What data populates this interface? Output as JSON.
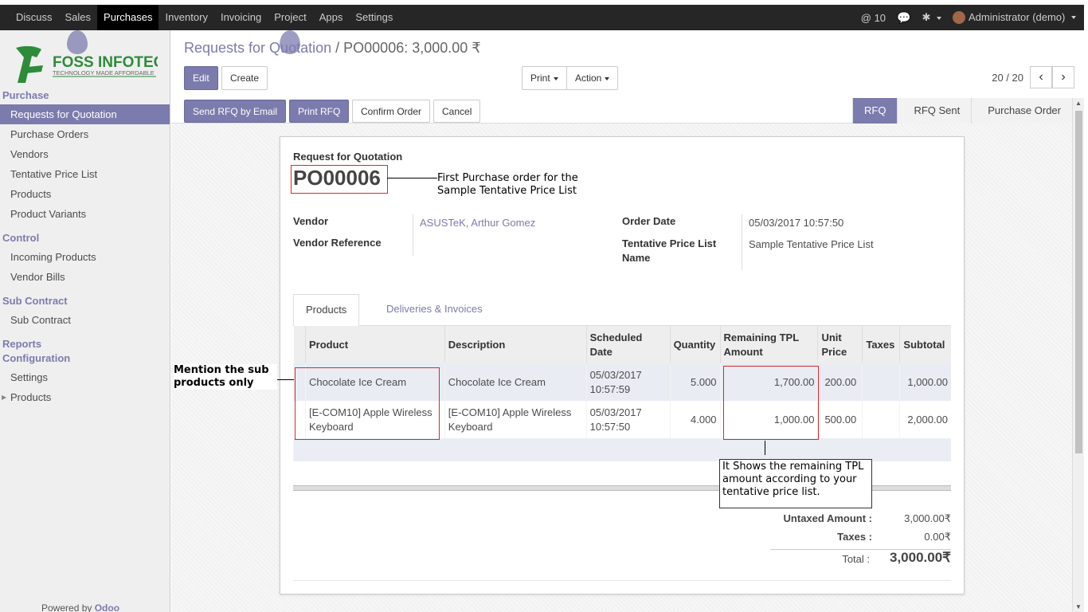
{
  "topbar": {
    "menus": [
      "Discuss",
      "Sales",
      "Purchases",
      "Inventory",
      "Invoicing",
      "Project",
      "Apps",
      "Settings"
    ],
    "active_menu": "Purchases",
    "notifications": "10",
    "user": "Administrator (demo)"
  },
  "sidebar": {
    "logo_text": "FOSS INFOTECH",
    "logo_tagline": "TECHNOLOGY MADE AFFORDABLE",
    "sections": {
      "purchase": "Purchase",
      "control": "Control",
      "sub_contract": "Sub Contract",
      "reports": "Reports",
      "configuration": "Configuration"
    },
    "items": {
      "rfq": "Requests for Quotation",
      "purchase_orders": "Purchase Orders",
      "vendors": "Vendors",
      "tentative_price_list": "Tentative Price List",
      "products": "Products",
      "product_variants": "Product Variants",
      "incoming_products": "Incoming Products",
      "vendor_bills": "Vendor Bills",
      "sub_contract": "Sub Contract",
      "settings": "Settings",
      "config_products": "Products"
    },
    "powered_by": "Powered by",
    "powered_brand": "Odoo"
  },
  "control": {
    "breadcrumb_parent": "Requests for Quotation",
    "breadcrumb_sep": "/",
    "breadcrumb_current": "PO00006: 3,000.00 ₹",
    "edit": "Edit",
    "create": "Create",
    "print": "Print",
    "action": "Action",
    "pager": "20 / 20"
  },
  "status": {
    "send_rfq": "Send RFQ by Email",
    "print_rfq": "Print RFQ",
    "confirm": "Confirm Order",
    "cancel": "Cancel",
    "stages": [
      "RFQ",
      "RFQ Sent",
      "Purchase Order"
    ],
    "active_stage": "RFQ"
  },
  "form": {
    "doc_type": "Request for Quotation",
    "name": "PO00006",
    "vendor_label": "Vendor",
    "vendor": "ASUSTeK, Arthur Gomez",
    "vendor_ref_label": "Vendor Reference",
    "order_date_label": "Order Date",
    "order_date": "05/03/2017 10:57:50",
    "tpl_label": "Tentative Price List Name",
    "tpl_value": "Sample Tentative Price List",
    "tabs": [
      "Products",
      "Deliveries & Invoices"
    ],
    "columns": [
      "Product",
      "Description",
      "Scheduled Date",
      "Quantity",
      "Remaining TPL Amount",
      "Unit Price",
      "Taxes",
      "Subtotal"
    ],
    "lines": [
      {
        "product": "Chocolate Ice Cream",
        "description": "Chocolate Ice Cream",
        "date": "05/03/2017 10:57:59",
        "qty": "5.000",
        "tpl": "1,700.00",
        "price": "200.00",
        "taxes": "",
        "subtotal": "1,000.00"
      },
      {
        "product": "[E-COM10] Apple Wireless Keyboard",
        "description": "[E-COM10] Apple Wireless Keyboard",
        "date": "05/03/2017 10:57:50",
        "qty": "4.000",
        "tpl": "1,000.00",
        "price": "500.00",
        "taxes": "",
        "subtotal": "2,000.00"
      }
    ],
    "untaxed_label": "Untaxed Amount :",
    "untaxed": "3,000.00₹",
    "taxes_label": "Taxes :",
    "taxes": "0.00₹",
    "total_label": "Total :",
    "total": "3,000.00₹"
  },
  "annotations": {
    "first_po": "First Purchase order for the Sample Tentative Price List",
    "sub_products": "Mention the sub products only",
    "tpl_note": "It Shows the remaining TPL amount according to your tentative price list."
  },
  "colors": {
    "accent": "#7c7bad",
    "topbar": "#262626",
    "highlight": "#d62a2a"
  }
}
